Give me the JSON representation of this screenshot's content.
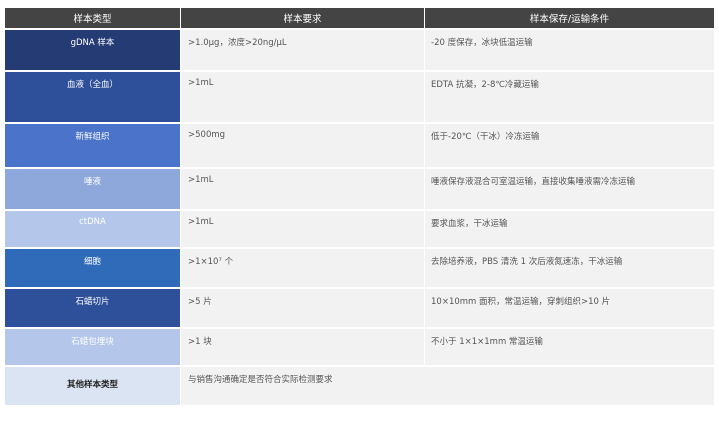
{
  "header": {
    "col_type": "样本类型",
    "col_requirement": "样本要求",
    "col_condition": "样本保存/运输条件"
  },
  "rows": [
    {
      "type": "gDNA 样本",
      "requirement": ">1.0μg，浓度>20ng/μL",
      "condition": "-20 度保存，冰块低温运输",
      "color": "#243b73"
    },
    {
      "type": "血液（全血）",
      "requirement": ">1mL",
      "condition": "EDTA 抗凝，2-8℃冷藏运输",
      "color": "#2e4f99"
    },
    {
      "type": "新鲜组织",
      "requirement": ">500mg",
      "condition": "低于-20℃（干冰）冷冻运输",
      "color": "#4a73c9"
    },
    {
      "type": "唾液",
      "requirement": ">1mL",
      "condition": "唾液保存液混合可室温运输，直接收集唾液需冷冻运输",
      "color": "#8ea8dc"
    },
    {
      "type": "ctDNA",
      "requirement": ">1mL",
      "condition": "要求血浆，干冰运输",
      "color": "#b4c6ea"
    },
    {
      "type": "细胞",
      "requirement": ">1×10⁷ 个",
      "condition": "去除培养液，PBS 清洗 1 次后液氮速冻，干冰运输",
      "color": "#2f6bb8"
    },
    {
      "type": "石蜡切片",
      "requirement": ">5 片",
      "condition": "10×10mm 面积，常温运输，穿刺组织>10 片",
      "color": "#2e4f99"
    },
    {
      "type": "石蜡包埋块",
      "requirement": ">1 块",
      "condition": "不小于 1×1×1mm 常温运输",
      "color": "#b4c6ea"
    },
    {
      "type": "其他样本类型",
      "requirement": "与销售沟通确定是否符合实际检测要求",
      "condition": "",
      "color": "#dbe4f3"
    }
  ]
}
